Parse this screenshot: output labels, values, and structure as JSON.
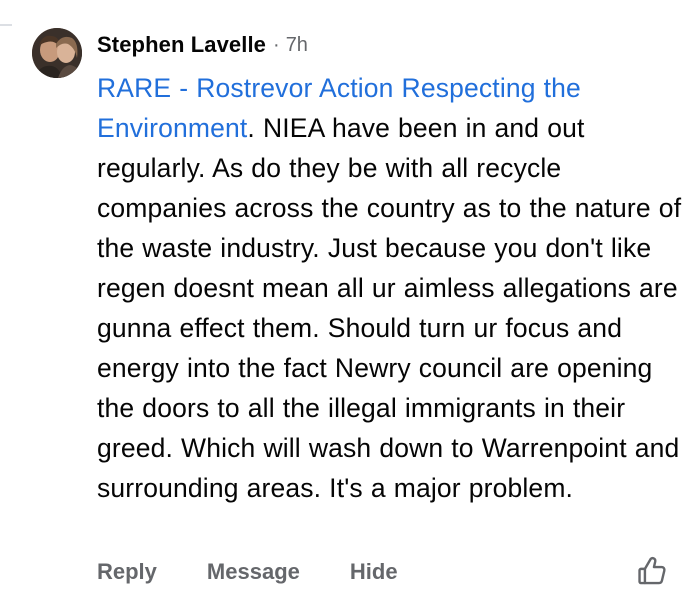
{
  "comment": {
    "author": "Stephen Lavelle",
    "separator": "·",
    "time": "7h",
    "mention": "RARE - Rostrevor Action Respecting the Environment",
    "text": ". NIEA have been in and out regularly. As do they be with all recycle companies across the country as to the nature of the waste industry. Just because you don't like regen doesnt mean all ur aimless allegations are gunna effect them. Should turn ur focus and energy into the fact Newry council are opening the doors to all the illegal immigrants in their greed. Which will wash down to Warrenpoint and surrounding areas. It's a major problem."
  },
  "actions": {
    "reply": "Reply",
    "message": "Message",
    "hide": "Hide"
  },
  "icons": {
    "like": "thumbs-up-icon",
    "avatar": "profile-photo"
  },
  "colors": {
    "link": "#216fdb",
    "text": "#050505",
    "muted": "#65676b"
  }
}
